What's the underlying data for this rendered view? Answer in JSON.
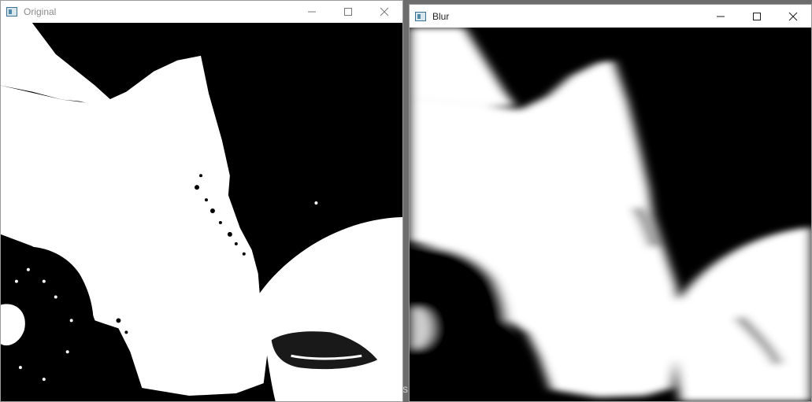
{
  "windows": [
    {
      "id": "original",
      "title": "Original",
      "active": false,
      "controls": [
        "minimize-icon",
        "maximize-icon",
        "close-icon"
      ]
    },
    {
      "id": "blur",
      "title": "Blur",
      "active": true,
      "controls": [
        "minimize-icon",
        "maximize-icon",
        "close-icon"
      ]
    }
  ],
  "background_fragment": "s",
  "colors": {
    "titlebar": "#ffffff",
    "image_foreground": "#ffffff",
    "image_background": "#000000"
  }
}
